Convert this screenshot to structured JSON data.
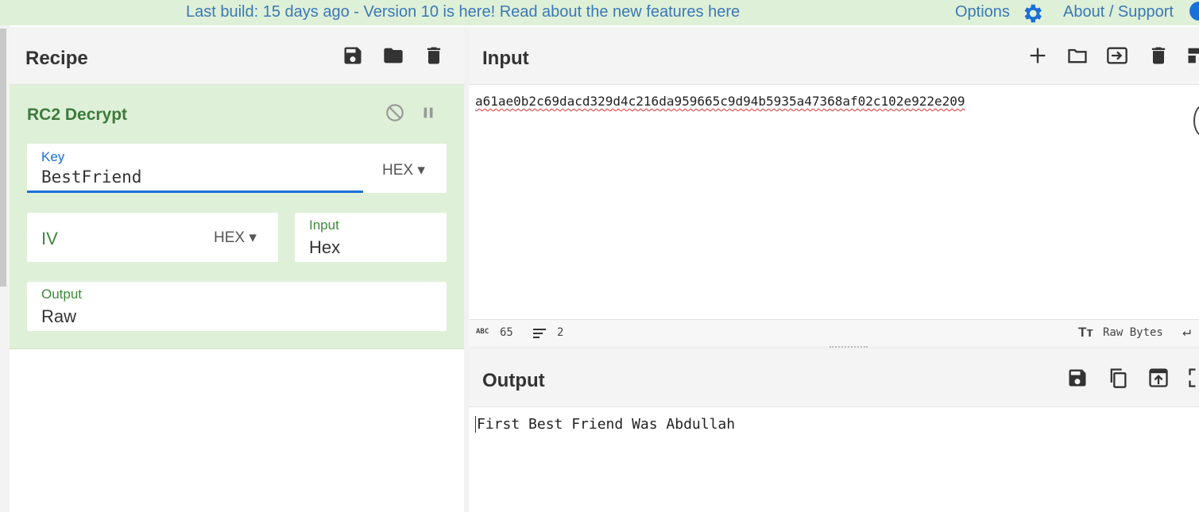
{
  "banner": {
    "message": "Last build: 15 days ago - Version 10 is here! Read about the new features here",
    "options_label": "Options",
    "about_label": "About / Support"
  },
  "recipe": {
    "title": "Recipe",
    "operation": {
      "name": "RC2 Decrypt",
      "key": {
        "label": "Key",
        "value": "BestFriend",
        "format": "HEX"
      },
      "iv": {
        "placeholder": "IV",
        "format": "HEX"
      },
      "input_type": {
        "label": "Input",
        "value": "Hex"
      },
      "output_type": {
        "label": "Output",
        "value": "Raw"
      }
    }
  },
  "input": {
    "title": "Input",
    "text": "a61ae0b2c69dacd329d4c216da959665c9d94b5935a47368af02c102e922e209",
    "status": {
      "length": "65",
      "lines": "2",
      "encoding": "Raw Bytes"
    }
  },
  "output": {
    "title": "Output",
    "text": "First Best Friend Was Abdullah"
  },
  "colors": {
    "banner_bg": "#dff0d8",
    "link": "#3a78b5",
    "op_bg": "#dff0d8",
    "op_title": "#3c7a3c",
    "active_underline": "#1a6fd8"
  }
}
